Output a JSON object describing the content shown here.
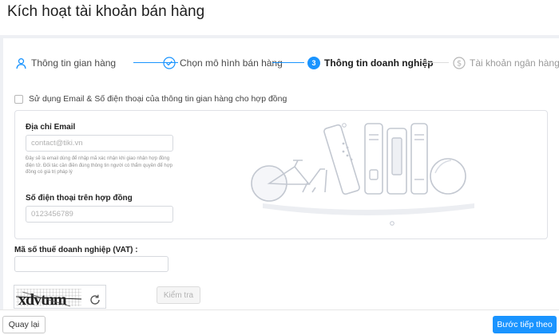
{
  "page": {
    "title": "Kích hoạt tài khoản bán hàng"
  },
  "steps": [
    {
      "label": "Thông tin gian hàng",
      "state": "done",
      "icon": "user-icon"
    },
    {
      "label": "Chọn mô hình bán hàng",
      "state": "done",
      "icon": "check-circle-icon"
    },
    {
      "label": "Thông tin doanh nghiệp",
      "state": "active",
      "number": "3"
    },
    {
      "label": "Tài khoản ngân hàng",
      "state": "pending",
      "icon": "dollar-circle-icon"
    }
  ],
  "use_store_contact": {
    "label": "Sử dụng Email & Số điện thoại của thông tin gian hàng cho hợp đồng",
    "checked": false
  },
  "email": {
    "label": "Địa chỉ Email",
    "placeholder": "contact@tiki.vn",
    "hint": "Đây sẽ là email dùng để nhập mã xác nhận khi giao nhận hợp đồng điện tử. Đối tác cần điền đúng thông tin người có thẩm quyền để hợp đồng có giá trị pháp lý"
  },
  "phone": {
    "label": "Số điện thoại trên hợp đồng",
    "placeholder": "0123456789"
  },
  "tax_code": {
    "label": "Mã số thuế doanh nghiệp (VAT) :",
    "value": ""
  },
  "captcha": {
    "text": "xdvtnm",
    "check_label": "Kiểm tra"
  },
  "footer": {
    "back_label": "Quay lại",
    "next_label": "Bước tiếp theo"
  },
  "colors": {
    "accent": "#1a94ff",
    "connector_done": "#1a94ff",
    "connector_pending": "#dcdcdc",
    "pending_text": "#9a9a9a"
  }
}
